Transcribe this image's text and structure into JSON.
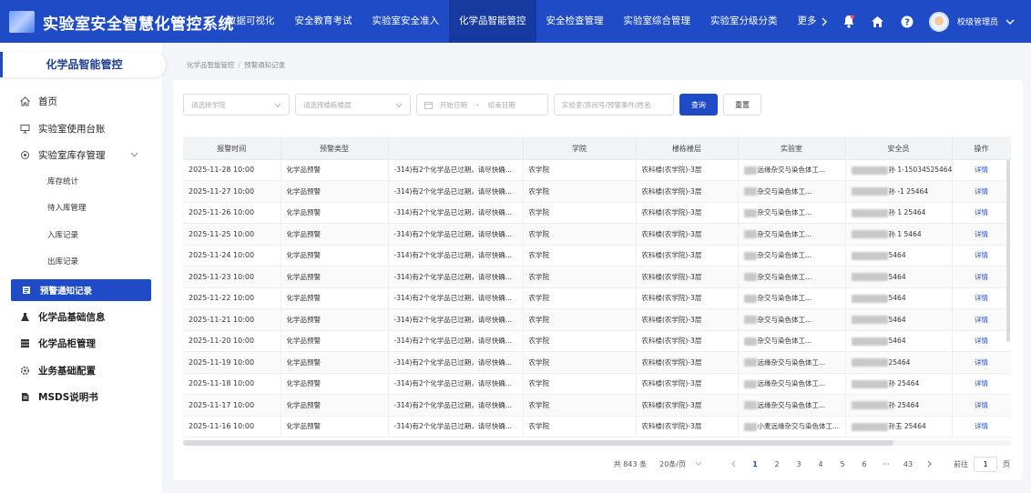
{
  "app": {
    "title": "实验室安全智慧化管控系统"
  },
  "nav": [
    {
      "label": "数据可视化",
      "active": false
    },
    {
      "label": "安全教育考试",
      "active": false
    },
    {
      "label": "实验室安全准入",
      "active": false
    },
    {
      "label": "化学品智能管控",
      "active": true
    },
    {
      "label": "安全检查管理",
      "active": false
    },
    {
      "label": "实验室综合管理",
      "active": false
    },
    {
      "label": "实验室分级分类",
      "active": false
    }
  ],
  "nav_more": "更多",
  "user": {
    "name": "校级管理员"
  },
  "icons": {
    "bell": "bell-icon",
    "home": "home-icon",
    "help": "help-icon"
  },
  "sidebar": {
    "title": "化学品智能管控",
    "items": {
      "home": "首页",
      "ledger": "实验室使用台账",
      "inventory": "实验室库存管理",
      "sub_stats": "库存统计",
      "sub_pending": "待入库管理",
      "sub_in": "入库记录",
      "sub_out": "出库记录",
      "warning": "预警通知记录",
      "chem_info": "化学品基础信息",
      "cabinet": "化学品柜管理",
      "config": "业务基础配置",
      "msds": "MSDS说明书"
    }
  },
  "breadcrumb": {
    "parent": "化学品智能管控",
    "sep": "/",
    "current": "预警通知记录"
  },
  "filters": {
    "college_placeholder": "请选择学院",
    "building_placeholder": "请选择楼栋楼层",
    "start_date": "开始日期",
    "date_sep": "-",
    "end_date": "结束日期",
    "search_placeholder": "实验室/房间号/预警事件/姓名",
    "query_label": "查询",
    "reset_label": "重置"
  },
  "table": {
    "columns": [
      "报警时间",
      "预警类型",
      "",
      "学院",
      "楼栋楼层",
      "实验室",
      "安全员",
      "操作"
    ],
    "action_label": "详情",
    "rows": [
      {
        "time": "2025-11-28 10:00",
        "type": "化学品预警",
        "event": "-314)有2个化学品已过期，请尽快确...",
        "college": "农学院",
        "building": "农科楼(农学院)-3层",
        "lab": "远缘杂交与染色体工...",
        "officer": "孙  1-15034525464"
      },
      {
        "time": "2025-11-27 10:00",
        "type": "化学品预警",
        "event": "-314)有2个化学品已过期，请尽快确...",
        "college": "农学院",
        "building": "农科楼(农学院)-3层",
        "lab": "杂交与染色体工...",
        "officer": "孙  -1  25464"
      },
      {
        "time": "2025-11-26 10:00",
        "type": "化学品预警",
        "event": "-314)有2个化学品已过期，请尽快确...",
        "college": "农学院",
        "building": "农科楼(农学院)-3层",
        "lab": "杂交与染色体工...",
        "officer": "孙  1  25464"
      },
      {
        "time": "2025-11-25 10:00",
        "type": "化学品预警",
        "event": "-314)有2个化学品已过期，请尽快确...",
        "college": "农学院",
        "building": "农科楼(农学院)-3层",
        "lab": "杂交与染色体工...",
        "officer": "孙  1  5464"
      },
      {
        "time": "2025-11-24 10:00",
        "type": "化学品预警",
        "event": "-314)有2个化学品已过期，请尽快确...",
        "college": "农学院",
        "building": "农科楼(农学院)-3层",
        "lab": "杂交与染色体工...",
        "officer": "5464"
      },
      {
        "time": "2025-11-23 10:00",
        "type": "化学品预警",
        "event": "-314)有2个化学品已过期，请尽快确...",
        "college": "农学院",
        "building": "农科楼(农学院)-3层",
        "lab": "杂交与染色体工...",
        "officer": "5464"
      },
      {
        "time": "2025-11-22 10:00",
        "type": "化学品预警",
        "event": "-314)有2个化学品已过期，请尽快确...",
        "college": "农学院",
        "building": "农科楼(农学院)-3层",
        "lab": "杂交与染色体工...",
        "officer": "5464"
      },
      {
        "time": "2025-11-21 10:00",
        "type": "化学品预警",
        "event": "-314)有2个化学品已过期，请尽快确...",
        "college": "农学院",
        "building": "农科楼(农学院)-3层",
        "lab": "杂交与染色体工...",
        "officer": "5464"
      },
      {
        "time": "2025-11-20 10:00",
        "type": "化学品预警",
        "event": "-314)有2个化学品已过期，请尽快确...",
        "college": "农学院",
        "building": "农科楼(农学院)-3层",
        "lab": "杂交与染色体工...",
        "officer": "5464"
      },
      {
        "time": "2025-11-19 10:00",
        "type": "化学品预警",
        "event": "-314)有2个化学品已过期，请尽快确...",
        "college": "农学院",
        "building": "农科楼(农学院)-3层",
        "lab": "远缘杂交与染色体工...",
        "officer": "25464"
      },
      {
        "time": "2025-11-18 10:00",
        "type": "化学品预警",
        "event": "-314)有2个化学品已过期，请尽快确...",
        "college": "农学院",
        "building": "农科楼(农学院)-3层",
        "lab": "远缘杂交与染色体工...",
        "officer": "孙  25464"
      },
      {
        "time": "2025-11-17 10:00",
        "type": "化学品预警",
        "event": "-314)有2个化学品已过期，请尽快确...",
        "college": "农学院",
        "building": "农科楼(农学院)-3层",
        "lab": "远缘杂交与染色体工...",
        "officer": "孙  25464"
      },
      {
        "time": "2025-11-16 10:00",
        "type": "化学品预警",
        "event": "-314)有2个化学品已过期，请尽快确...",
        "college": "农学院",
        "building": "农科楼(农学院)-3层",
        "lab": "小麦远缘杂交与染色体工...",
        "officer": "孙玉  25464"
      }
    ]
  },
  "pagination": {
    "total": "共 843 条",
    "page_size": "20条/页",
    "pages": [
      "1",
      "2",
      "3",
      "4",
      "5",
      "6",
      "···",
      "43"
    ],
    "current": "1",
    "goto_label": "前往",
    "goto_value": "1",
    "page_unit": "页"
  },
  "colors": {
    "primary": "#1f4bc6",
    "topbar": "#1f4bc6",
    "nav_active": "#163a9f",
    "link": "#1f4bc6"
  }
}
